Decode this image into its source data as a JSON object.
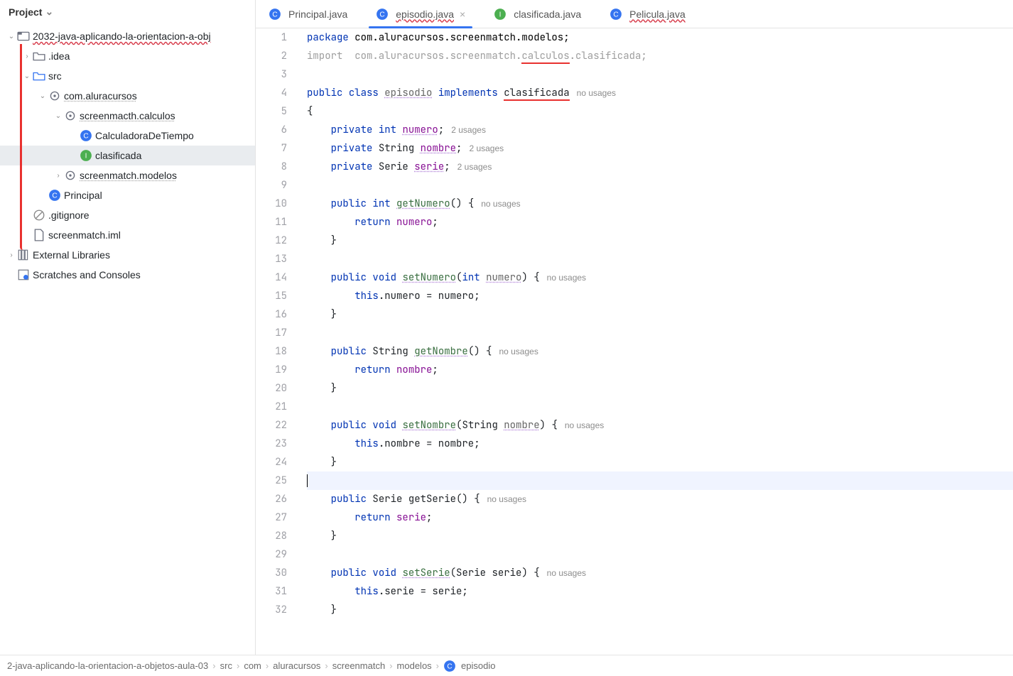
{
  "sidebar": {
    "title": "Project",
    "tree": [
      {
        "indent": 0,
        "arrow": "down",
        "icon": "module",
        "label": "2032-java-aplicando-la-orientacion-a-obj",
        "red": true
      },
      {
        "indent": 1,
        "arrow": "right",
        "icon": "folder",
        "label": ".idea"
      },
      {
        "indent": 1,
        "arrow": "down",
        "icon": "folder-src",
        "label": "src"
      },
      {
        "indent": 2,
        "arrow": "down",
        "icon": "package",
        "label": "com.aluracursos",
        "dotted": true
      },
      {
        "indent": 3,
        "arrow": "down",
        "icon": "package",
        "label": "screenmacth.calculos",
        "dotted": true
      },
      {
        "indent": 4,
        "arrow": "",
        "icon": "class",
        "label": "CalculadoraDeTiempo"
      },
      {
        "indent": 4,
        "arrow": "",
        "icon": "interface",
        "label": "clasificada",
        "selected": true
      },
      {
        "indent": 3,
        "arrow": "right",
        "icon": "package",
        "label": "screenmatch.modelos",
        "dotted": true
      },
      {
        "indent": 2,
        "arrow": "",
        "icon": "class",
        "label": "Principal"
      },
      {
        "indent": 1,
        "arrow": "",
        "icon": "ignore",
        "label": ".gitignore"
      },
      {
        "indent": 1,
        "arrow": "",
        "icon": "file",
        "label": "screenmatch.iml"
      },
      {
        "indent": 0,
        "arrow": "right",
        "icon": "lib",
        "label": "External Libraries"
      },
      {
        "indent": 0,
        "arrow": "",
        "icon": "scratch",
        "label": "Scratches and Consoles"
      }
    ]
  },
  "tabs": [
    {
      "icon": "class",
      "label": "Principal.java",
      "active": false,
      "red": false
    },
    {
      "icon": "class",
      "label": "episodio.java",
      "active": true,
      "red": true,
      "closable": true
    },
    {
      "icon": "interface",
      "label": "clasificada.java",
      "active": false,
      "red": false
    },
    {
      "icon": "class",
      "label": "Pelicula.java",
      "active": false,
      "red": true
    }
  ],
  "editor": {
    "line_start": 1,
    "line_end": 32,
    "current_line": 25
  },
  "code": {
    "l1_kw": "package",
    "l1_pkg": " com.aluracursos.screenmatch.modelos;",
    "l2_kw": "import",
    "l2_a": "  com.aluracursos.screenmatch.",
    "l2_b": "calculos",
    "l2_c": ".clasificada;",
    "l4_a": "public",
    "l4_b": "class",
    "l4_c": "episodio",
    "l4_d": "implements",
    "l4_e": "clasificada",
    "l4_hint": "no usages",
    "l5": "{",
    "l6_a": "private",
    "l6_b": "int",
    "l6_c": "numero",
    "l6_sc": ";",
    "l6_hint": "2 usages",
    "l7_a": "private",
    "l7_b": "String ",
    "l7_c": "nombre",
    "l7_sc": ";",
    "l7_hint": "2 usages",
    "l8_a": "private",
    "l8_b": "Serie ",
    "l8_c": "serie",
    "l8_sc": ";",
    "l8_hint": "2 usages",
    "l10_a": "public",
    "l10_b": "int",
    "l10_c": "getNumero",
    "l10_d": "() {",
    "l10_hint": "no usages",
    "l11_a": "return",
    "l11_b": "numero",
    "l11_sc": ";",
    "l12": "}",
    "l14_a": "public",
    "l14_b": "void",
    "l14_c": "setNumero",
    "l14_d": "(",
    "l14_e": "int",
    "l14_f": "numero",
    "l14_g": ") {",
    "l14_hint": "no usages",
    "l15_a": "this",
    "l15_b": ".numero = numero;",
    "l16": "}",
    "l18_a": "public",
    "l18_b": "String ",
    "l18_c": "getNombre",
    "l18_d": "() {",
    "l18_hint": "no usages",
    "l19_a": "return",
    "l19_b": "nombre",
    "l19_sc": ";",
    "l20": "}",
    "l22_a": "public",
    "l22_b": "void",
    "l22_c": "setNombre",
    "l22_d": "(String ",
    "l22_e": "nombre",
    "l22_f": ") {",
    "l22_hint": "no usages",
    "l23_a": "this",
    "l23_b": ".nombre = nombre;",
    "l24": "}",
    "l26_a": "public",
    "l26_b": "Serie getSerie() {",
    "l26_hint": "no usages",
    "l27_a": "return",
    "l27_b": "serie",
    "l27_sc": ";",
    "l28": "}",
    "l30_a": "public",
    "l30_b": "void",
    "l30_c": "setSerie",
    "l30_d": "(Serie serie) {",
    "l30_hint": "no usages",
    "l31_a": "this",
    "l31_b": ".serie = serie;",
    "l32": "}"
  },
  "breadcrumb": [
    "2-java-aplicando-la-orientacion-a-objetos-aula-03",
    "src",
    "com",
    "aluracursos",
    "screenmatch",
    "modelos",
    "episodio"
  ]
}
